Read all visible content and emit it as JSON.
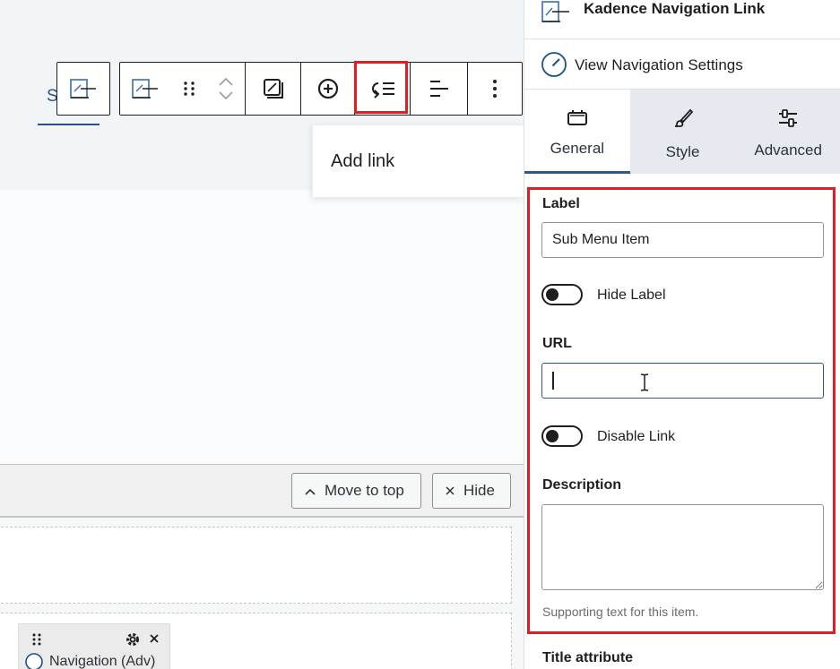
{
  "canvas": {
    "nav_preview_text": "S     M",
    "add_link_label": "Add link",
    "meta_buttons": {
      "move_to_top": "Move to top",
      "hide": "Hide"
    },
    "widget_title": "Navigation (Adv)"
  },
  "toolbar": {
    "icons": [
      "navigation-link-icon",
      "drag-handle-icon",
      "move-up-icon",
      "move-down-icon",
      "replace-icon",
      "add-icon",
      "add-submenu-icon",
      "align-icon",
      "more-options-icon"
    ]
  },
  "sidebar": {
    "block_title": "Kadence Navigation Link",
    "view_settings_label": "View Navigation Settings",
    "tabs": [
      {
        "label": "General",
        "icon": "general-icon",
        "active": true
      },
      {
        "label": "Style",
        "icon": "brush-icon",
        "active": false
      },
      {
        "label": "Advanced",
        "icon": "sliders-icon",
        "active": false
      }
    ],
    "fields": {
      "label_title": "Label",
      "label_value": "Sub Menu Item",
      "hide_label_toggle": "Hide Label",
      "url_title": "URL",
      "url_value": "",
      "disable_link_toggle": "Disable Link",
      "description_title": "Description",
      "description_help": "Supporting text for this item.",
      "title_attribute_title": "Title attribute"
    }
  },
  "colors": {
    "highlight": "#e31b23",
    "accent": "#2d5a8a",
    "nav_text": "#2d4f86"
  }
}
